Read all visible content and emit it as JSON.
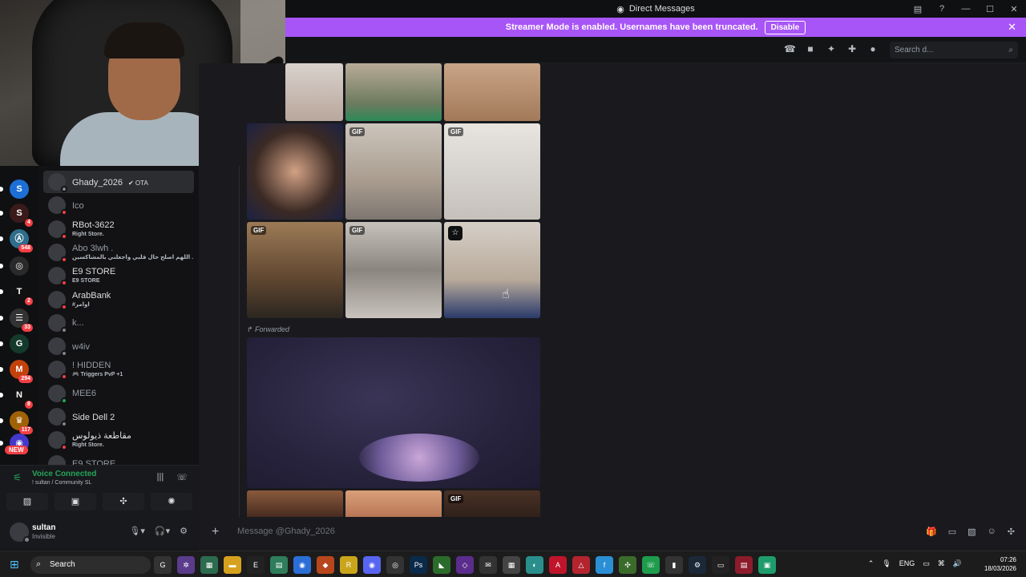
{
  "window": {
    "title": "Direct Messages",
    "minimize": "—",
    "maximize": "☐",
    "close": "✕"
  },
  "banner": {
    "text": "Streamer Mode is enabled. Usernames have been truncated.",
    "button": "Disable",
    "close": "✕"
  },
  "header": {
    "search_placeholder": "Search d...",
    "icons": [
      "phone-icon",
      "video-icon",
      "pin-icon",
      "add-friend-icon",
      "profile-icon"
    ]
  },
  "servers": [
    {
      "label": "S",
      "badge": "",
      "color": "#1d6fd6"
    },
    {
      "label": "S",
      "badge": "4",
      "color": "#3a1a1a"
    },
    {
      "label": "Ⓐ",
      "badge": "548",
      "color": "#2f6d8c"
    },
    {
      "label": "◎",
      "badge": "",
      "color": "#2a2a2a"
    },
    {
      "label": "T",
      "badge": "2",
      "color": "#111"
    },
    {
      "label": "☰",
      "badge": "33",
      "color": "#333"
    },
    {
      "label": "G",
      "badge": "",
      "color": "#143a2c"
    },
    {
      "label": "M",
      "badge": "294",
      "color": "#c2410c"
    },
    {
      "label": "N",
      "badge": "8",
      "color": "#111"
    },
    {
      "label": "♛",
      "badge": "117",
      "color": "#a16207"
    },
    {
      "label": "◉",
      "badge": "",
      "color": "#4338ca"
    }
  ],
  "new_label": "NEW",
  "dms": [
    {
      "name": "Ghady_2026",
      "tag": "✔ OTA",
      "sub": "",
      "status": "off",
      "selected": true
    },
    {
      "name": "Ico",
      "tag": "",
      "sub": "",
      "status": "dnd",
      "dim": true
    },
    {
      "name": "RBot-3622",
      "tag": "",
      "sub": "Right Store.",
      "status": "dnd"
    },
    {
      "name": "Abo 3lwh .",
      "tag": "",
      "sub": "اللهم اصلح حال قلبي واجعلني بالمشاكسين .",
      "status": "dnd",
      "dim": true
    },
    {
      "name": "E9 STORE",
      "tag": "",
      "sub": "E9 STORE",
      "status": "dnd"
    },
    {
      "name": "ArabBank",
      "tag": "",
      "sub": "#اوامر",
      "status": "dnd"
    },
    {
      "name": "k...",
      "tag": "",
      "sub": "",
      "status": "off",
      "dim": true
    },
    {
      "name": "w4iv",
      "tag": "",
      "sub": "",
      "status": "off",
      "dim": true
    },
    {
      "name": "! HIDDEN",
      "tag": "",
      "sub": "🎮 Triggers PvP +1",
      "status": "dnd",
      "dim": true
    },
    {
      "name": "MEE6",
      "tag": "",
      "sub": "",
      "status": "on",
      "dim": true
    },
    {
      "name": "Side Dell 2",
      "tag": "",
      "sub": "",
      "status": "off"
    },
    {
      "name": "مقاطعة ذيولوس",
      "tag": "",
      "sub": "Right Store.",
      "status": "dnd"
    },
    {
      "name": "E9 STORE",
      "tag": "",
      "sub": "",
      "status": "dnd",
      "dim": true
    }
  ],
  "voice": {
    "title": "Voice Connected",
    "sub": "! sultan / Community SL"
  },
  "user": {
    "name": "sultan",
    "status": "Invisible"
  },
  "chat": {
    "gif_label": "GIF",
    "forwarded": "Forwarded"
  },
  "composer": {
    "placeholder": "Message @Ghady_2026",
    "plus": "+"
  },
  "taskbar": {
    "search": "Search",
    "lang": "ENG",
    "time": "07:26",
    "date": "18/03/2026"
  }
}
